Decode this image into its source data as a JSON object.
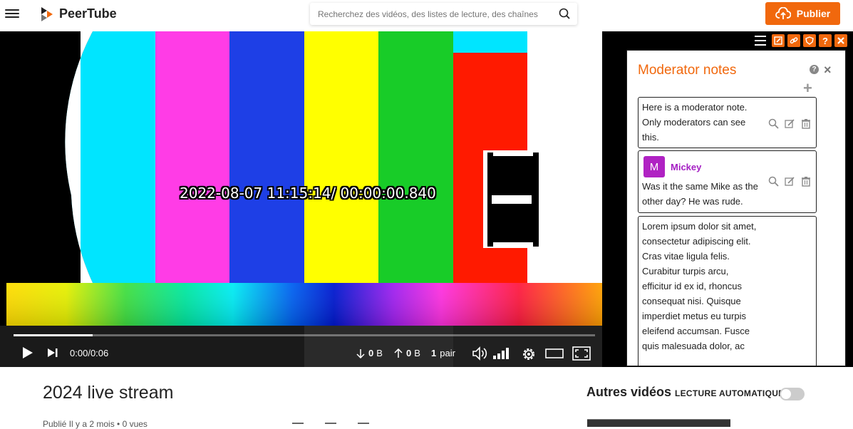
{
  "header": {
    "logo_text": "PeerTube",
    "search_placeholder": "Recherchez des vidéos, des listes de lecture, des chaînes",
    "publish_label": "Publier",
    "accent": "#f1680d"
  },
  "player": {
    "overlay_timestamp": "2022-08-07 11:15:14/ 00:00:00.840",
    "progress_fraction": 0.136,
    "time_current": "0:00",
    "time_separator": "/",
    "time_total": "0:06",
    "down_value": "0",
    "down_unit": "B",
    "up_value": "0",
    "up_unit": "B",
    "peers_value": "1",
    "peers_label": "pair",
    "icons": [
      "play-icon",
      "next-icon",
      "volume-icon",
      "quality-icon",
      "settings-icon",
      "theater-icon",
      "fullscreen-icon"
    ]
  },
  "chat": {
    "toolbar_icons": [
      "menu-icon",
      "edit-icon",
      "link-icon",
      "shield-icon",
      "help-icon",
      "close-icon"
    ],
    "notes_title": "Moderator notes",
    "help_glyph": "?",
    "close_glyph": "×",
    "add_glyph": "+",
    "notes": [
      {
        "text_lines": [
          "Here is a moderator note.",
          "Only moderators can see",
          "this."
        ]
      },
      {
        "author_initial": "M",
        "author_name": "Mickey",
        "text_lines": [
          "Was it the same Mike as the",
          "other day? He was rude."
        ]
      },
      {
        "text_lines": [
          "Lorem ipsum dolor sit amet,",
          "consectetur adipiscing elit.",
          "Cras vitae ligula felis.",
          "Curabitur turpis arcu,",
          "efficitur id ex id, rhoncus",
          "consequat nisi. Quisque",
          "imperdiet metus eu turpis",
          "eleifend accumsan. Fusce",
          "quis malesuada dolor, ac"
        ]
      }
    ]
  },
  "video": {
    "title": "2024 live stream",
    "meta": "Publié Il y a 2 mois • 0 vues"
  },
  "sidebar": {
    "other_videos_title": "Autres vidéos",
    "autoplay_label": "LECTURE AUTOMATIQUE",
    "autoplay_on": false
  }
}
